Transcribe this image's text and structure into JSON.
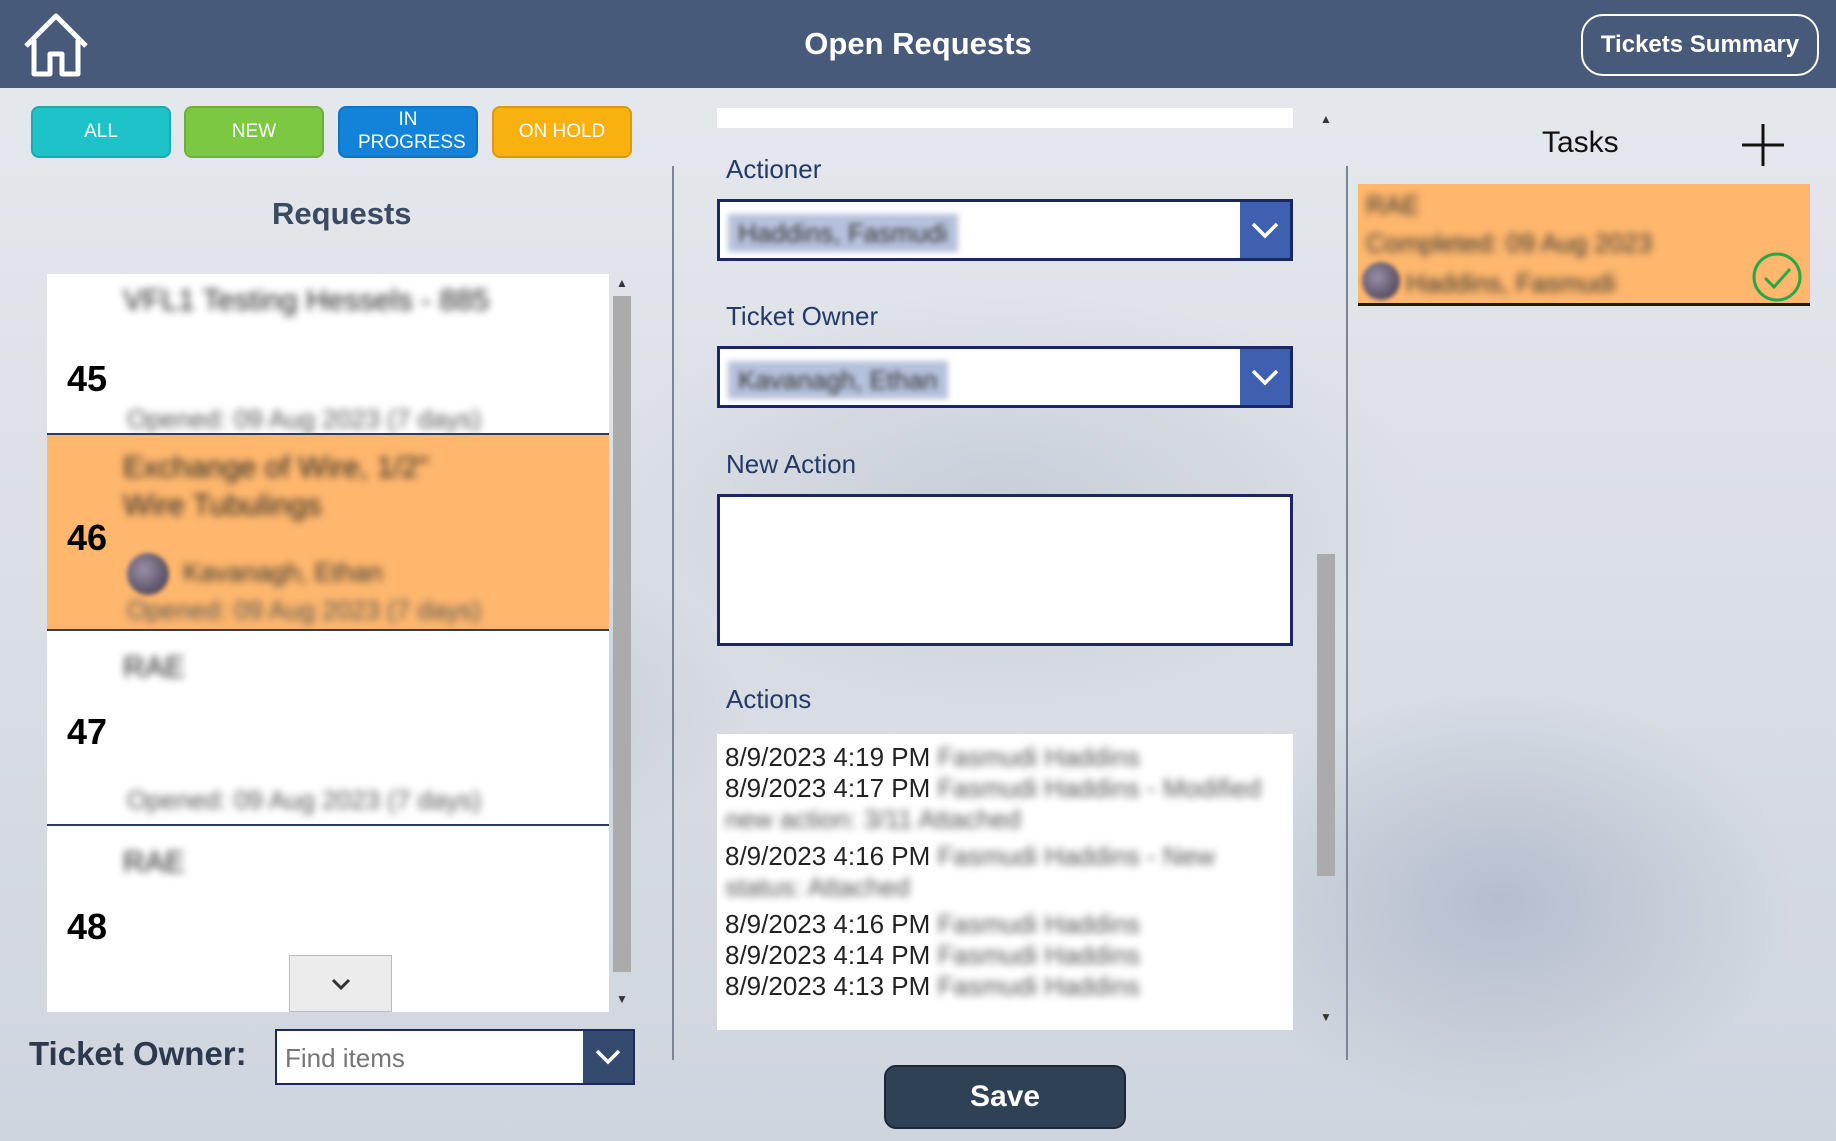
{
  "header": {
    "title": "Open Requests",
    "summary_button": "Tickets Summary"
  },
  "filters": {
    "all": "ALL",
    "new": "NEW",
    "in_progress": "IN PROGRESS",
    "on_hold": "ON HOLD"
  },
  "requests": {
    "title": "Requests",
    "rows": [
      {
        "id": "45",
        "title": "VFL1 Testing Hessels - 885",
        "owner": "",
        "date": "Opened: 09 Aug 2023 (7 days)"
      },
      {
        "id": "46",
        "title": "Exchange of Wire, 1/2\" Wire Tubulings",
        "owner": "Kavanagh, Ethan",
        "date": "Opened: 09 Aug 2023 (7 days)"
      },
      {
        "id": "47",
        "title": "RAE",
        "owner": "",
        "date": "Opened: 09 Aug 2023 (7 days)"
      },
      {
        "id": "48",
        "title": "RAE",
        "owner": "",
        "date": ""
      }
    ]
  },
  "owner_filter": {
    "label": "Ticket Owner:",
    "placeholder": "Find items"
  },
  "detail": {
    "actioner_label": "Actioner",
    "actioner_value": "Haddins, Fasmudi",
    "owner_label": "Ticket Owner",
    "owner_value": "Kavanagh, Ethan",
    "new_action_label": "New Action",
    "actions_label": "Actions",
    "actions": [
      {
        "time": "8/9/2023 4:19 PM",
        "text": "Fasmudi Haddins",
        "extra": ""
      },
      {
        "time": "8/9/2023 4:17 PM",
        "text": "Fasmudi Haddins - Modified",
        "extra": "new action: 3/11 Attached"
      },
      {
        "time": "8/9/2023 4:16 PM",
        "text": "Fasmudi Haddins - New",
        "extra": "status: Attached"
      },
      {
        "time": "8/9/2023 4:16 PM",
        "text": "Fasmudi Haddins",
        "extra": ""
      },
      {
        "time": "8/9/2023 4:14 PM",
        "text": "Fasmudi Haddins",
        "extra": ""
      },
      {
        "time": "8/9/2023 4:13 PM",
        "text": "Fasmudi Haddins",
        "extra": ""
      }
    ],
    "save_label": "Save"
  },
  "tasks": {
    "title": "Tasks",
    "items": [
      {
        "name": "RAE",
        "status": "Completed: 09 Aug 2023",
        "owner": "Haddins, Fasmudi"
      }
    ]
  },
  "colors": {
    "header": "#475a7a",
    "selected_row": "#feb76d",
    "all": "#1ec2c9",
    "new": "#7dc843",
    "in_progress": "#1283d8",
    "on_hold": "#f8b10e",
    "save": "#2f4155"
  }
}
